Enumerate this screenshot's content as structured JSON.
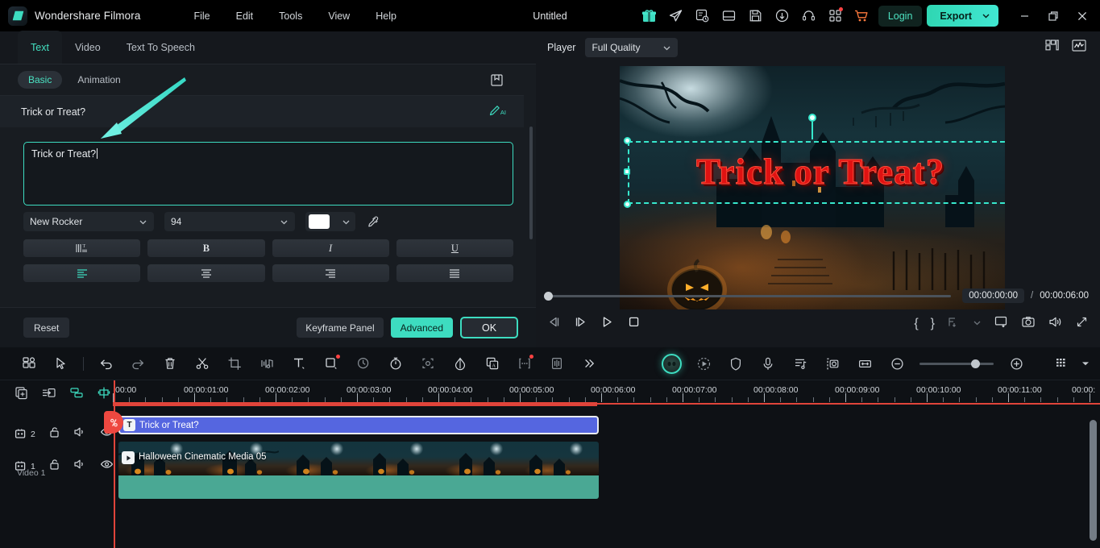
{
  "titlebar": {
    "brand": "Wondershare Filmora",
    "project_title": "Untitled",
    "menus": [
      "File",
      "Edit",
      "Tools",
      "View",
      "Help"
    ],
    "icons": [
      "gift-icon",
      "send-icon",
      "tasks-icon",
      "layout-icon",
      "save-icon",
      "cloud-upload-icon",
      "headset-icon",
      "apps-grid-icon",
      "cart-icon"
    ],
    "login_label": "Login",
    "export_label": "Export",
    "accent": "#3ddcc0"
  },
  "left_panel": {
    "tabs": [
      {
        "label": "Text",
        "active": true
      },
      {
        "label": "Video",
        "active": false
      },
      {
        "label": "Text To Speech",
        "active": false
      }
    ],
    "sub_tabs": [
      {
        "label": "Basic",
        "active": true
      },
      {
        "label": "Animation",
        "active": false
      }
    ],
    "save_preset_icon": "save-preset-icon",
    "selected_text_label": "Trick or Treat?",
    "ai_icon": "ai-pen-icon",
    "ai_icon_sub": "AI",
    "text_input_value": "Trick or Treat?",
    "font_family_value": "New Rocker",
    "font_size_value": "94",
    "font_color": "#ffffff",
    "eyedropper_icon": "eyedropper-icon",
    "format_buttons": [
      {
        "name": "vertical-text-button",
        "glyph": "",
        "label": "vertical-text"
      },
      {
        "name": "bold-button",
        "glyph": "B",
        "label": "B"
      },
      {
        "name": "italic-button",
        "glyph": "I",
        "label": "I"
      },
      {
        "name": "underline-button",
        "glyph": "U",
        "label": "U"
      }
    ],
    "align_buttons": [
      {
        "name": "align-left-button",
        "active": true
      },
      {
        "name": "align-center-button",
        "active": false
      },
      {
        "name": "align-right-button",
        "active": false
      },
      {
        "name": "align-justify-button",
        "active": false
      }
    ],
    "reset_label": "Reset",
    "keyframe_label": "Keyframe Panel",
    "advanced_label": "Advanced",
    "ok_label": "OK"
  },
  "player": {
    "label": "Player",
    "quality_value": "Full Quality",
    "head_icons": [
      "grid-view-icon",
      "waveform-icon"
    ],
    "preview_text": "Trick or Treat?",
    "current_time": "00:00:00:00",
    "separator": "/",
    "total_time": "00:00:06:00",
    "controls": [
      "prev-frame-button",
      "step-back-button",
      "play-button",
      "stop-button"
    ],
    "mark_in": "{",
    "mark_out": "}",
    "right_icons": [
      "export-frame-icon",
      "screen-icon",
      "snapshot-icon",
      "volume-icon",
      "fullscreen-icon"
    ]
  },
  "timeline": {
    "toolbar_left_icons": [
      "media-library-icon",
      "select-tool-icon",
      "undo-icon",
      "redo-icon",
      "delete-icon",
      "split-icon",
      "crop-icon",
      "audio-detach-icon",
      "text-icon",
      "mask-icon",
      "speed-icon",
      "timer-icon",
      "motion-track-icon",
      "color-match-icon",
      "translate-icon",
      "more-icon",
      "audio-stretch-icon",
      "chevron-more-icon"
    ],
    "toolbar_right_icons": [
      "ai-assistant-icon",
      "auto-reframe-icon",
      "shield-icon",
      "mic-icon",
      "playlist-icon",
      "snapshot-track-icon",
      "fit-timeline-icon",
      "zoom-out-icon",
      "zoom-slider",
      "zoom-in-icon",
      "track-manager-icon",
      "dropdown-caret-icon"
    ],
    "left_buttons": [
      "add-track-icon",
      "import-icon",
      "group-icon",
      "marker-icon"
    ],
    "ruler_labels": [
      "00:00",
      "00:00:01:00",
      "00:00:02:00",
      "00:00:03:00",
      "00:00:04:00",
      "00:00:05:00",
      "00:00:06:00",
      "00:00:07:00",
      "00:00:08:00",
      "00:00:09:00",
      "00:00:10:00",
      "00:00:11:00",
      "00:00:"
    ],
    "playhead_time": "00:00:00:00",
    "tracks": [
      {
        "number": "2",
        "label": "",
        "icons": [
          "lock-icon",
          "mute-icon",
          "eye-icon"
        ],
        "clip": {
          "name": "Trick or Treat?",
          "type": "text",
          "badge": "T"
        }
      },
      {
        "number": "1",
        "label": "Video 1",
        "icons": [
          "lock-icon",
          "mute-icon",
          "eye-icon"
        ],
        "clip": {
          "name": "Halloween Cinematic Media 05",
          "type": "video",
          "badge": "play"
        }
      }
    ]
  }
}
